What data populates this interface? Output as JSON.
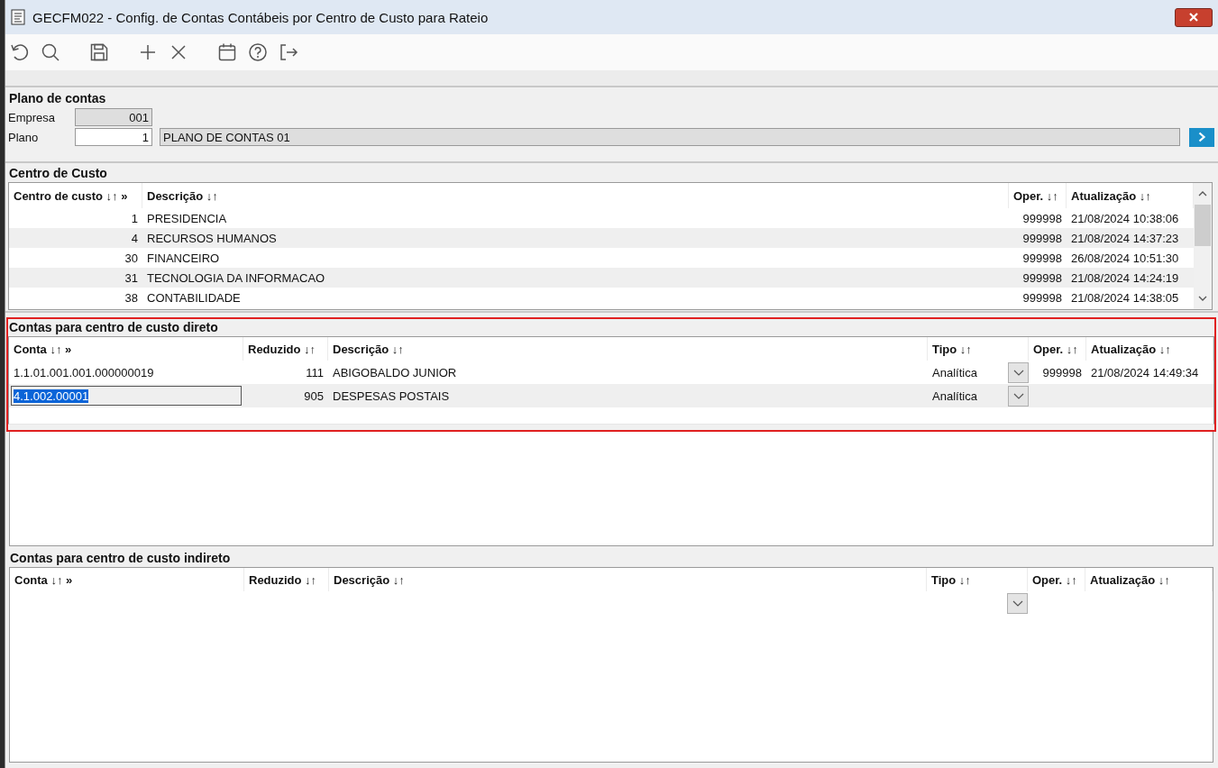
{
  "window": {
    "title": "GECFM022 - Config. de Contas Contábeis por Centro de Custo para Rateio"
  },
  "plano_de_contas": {
    "title": "Plano de contas",
    "empresa": {
      "label": "Empresa",
      "value": "001",
      "disabled": true
    },
    "plano": {
      "label": "Plano",
      "value": "1",
      "disabled": false,
      "description": "PLANO DE CONTAS 01"
    }
  },
  "centro_de_custo": {
    "title": "Centro de Custo",
    "columns": [
      "Centro de custo ↓↑ »",
      "Descrição ↓↑",
      "Oper. ↓↑",
      "Atualização ↓↑"
    ],
    "rows": [
      {
        "cells": [
          "1",
          "PRESIDENCIA",
          "999998",
          "21/08/2024 10:38:06"
        ]
      },
      {
        "cells": [
          "4",
          "RECURSOS HUMANOS",
          "999998",
          "21/08/2024 14:37:23"
        ]
      },
      {
        "cells": [
          "30",
          "FINANCEIRO",
          "999998",
          "26/08/2024 10:51:30"
        ]
      },
      {
        "cells": [
          "31",
          "TECNOLOGIA DA INFORMACAO",
          "999998",
          "21/08/2024 14:24:19"
        ]
      },
      {
        "cells": [
          "38",
          "CONTABILIDADE",
          "999998",
          "21/08/2024 14:38:05"
        ]
      }
    ]
  },
  "contas_direto": {
    "title": "Contas para centro de custo direto",
    "highlighted": true,
    "columns": [
      "Conta ↓↑ »",
      "Reduzido ↓↑",
      "Descrição ↓↑",
      "Tipo ↓↑",
      "Oper. ↓↑",
      "Atualização ↓↑"
    ],
    "rows": [
      {
        "conta": "1.1.01.001.001.000000019",
        "editing": false,
        "reduzido": "111",
        "descricao": "ABIGOBALDO JUNIOR",
        "tipo": "Analítica",
        "oper": "999998",
        "atualizacao": "21/08/2024 14:49:34"
      },
      {
        "conta": "4.1.002.00001",
        "editing": true,
        "reduzido": "905",
        "descricao": "DESPESAS POSTAIS",
        "tipo": "Analítica"
      }
    ]
  },
  "contas_indireto": {
    "title": "Contas para centro de custo indireto",
    "columns": [
      "Conta ↓↑ »",
      "Reduzido ↓↑",
      "Descrição ↓↑",
      "Tipo ↓↑",
      "Oper. ↓↑",
      "Atualização ↓↑"
    ],
    "empty_row_dropdown": true
  }
}
